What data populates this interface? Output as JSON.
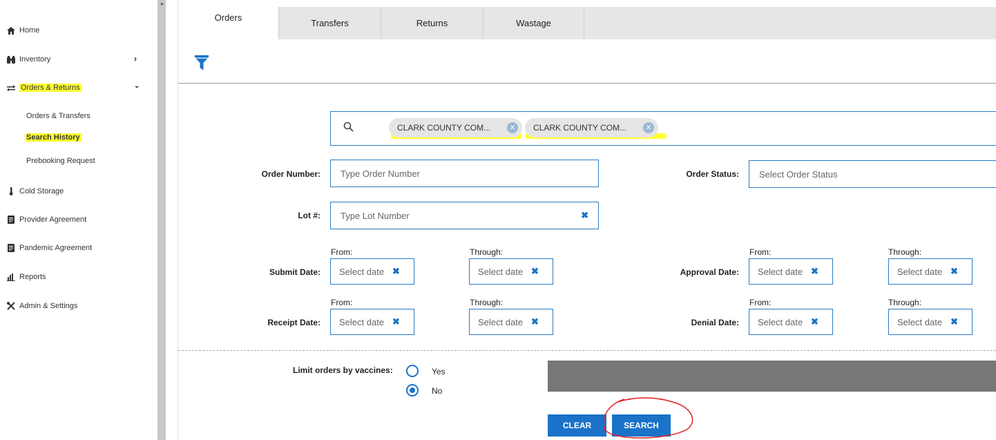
{
  "sidebar": {
    "home": "Home",
    "inventory": "Inventory",
    "orders_returns": "Orders & Returns",
    "orders_transfers": "Orders & Transfers",
    "search_history": "Search History",
    "prebooking": "Prebooking Request",
    "cold_storage": "Cold Storage",
    "provider_agreement": "Provider Agreement",
    "pandemic_agreement": "Pandemic Agreement",
    "reports": "Reports",
    "admin": "Admin & Settings"
  },
  "tabs": {
    "orders": "Orders",
    "transfers": "Transfers",
    "returns": "Returns",
    "wastage": "Wastage"
  },
  "chips": [
    "CLARK COUNTY COM...",
    "CLARK COUNTY COM..."
  ],
  "form": {
    "order_number_label": "Order Number:",
    "order_number_placeholder": "Type Order Number",
    "order_status_label": "Order Status:",
    "order_status_placeholder": "Select Order Status",
    "lot_label": "Lot #:",
    "lot_placeholder": "Type Lot Number",
    "from": "From:",
    "through": "Through:",
    "submit_date": "Submit Date:",
    "approval_date": "Approval Date:",
    "receipt_date": "Receipt Date:",
    "denial_date": "Denial Date:",
    "select_date": "Select date",
    "limit_label": "Limit orders by vaccines:",
    "yes": "Yes",
    "no": "No",
    "limit_selected": "No"
  },
  "buttons": {
    "clear": "CLEAR",
    "search": "SEARCH"
  },
  "colors": {
    "accent": "#1a73c8",
    "highlight": "#ffff33",
    "annotation": "#e02020"
  }
}
